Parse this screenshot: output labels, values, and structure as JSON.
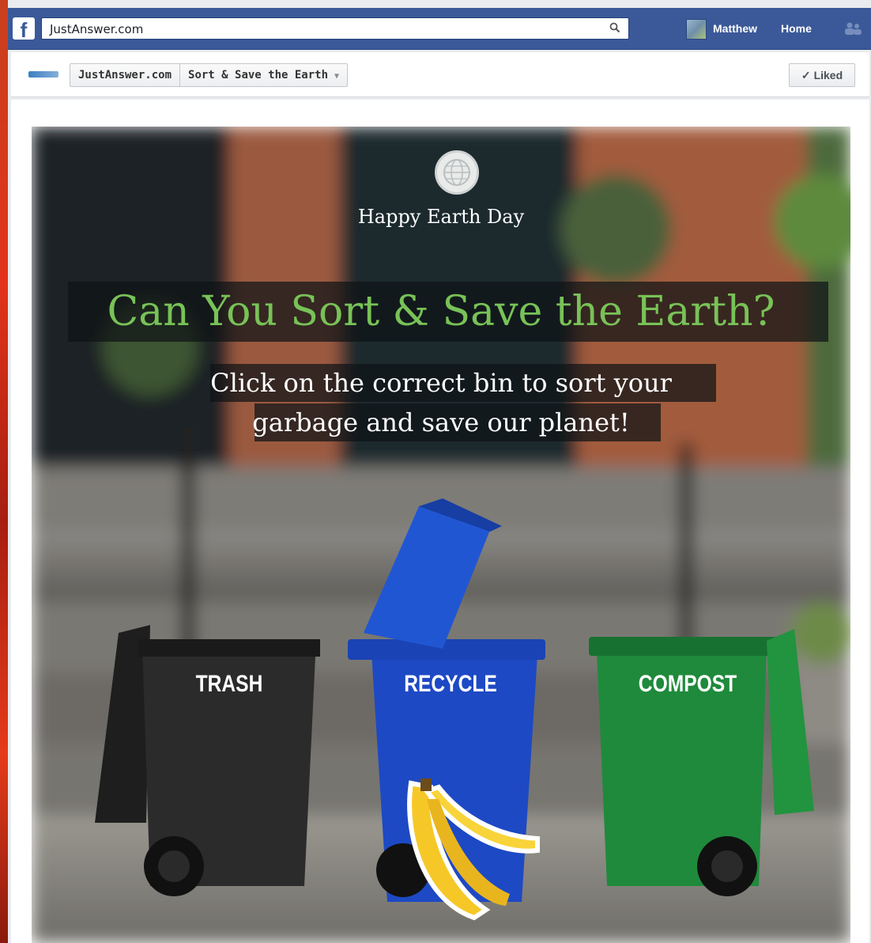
{
  "browser": {
    "search_text": "JustAnswer.com",
    "user_name": "Matthew",
    "home_label": "Home"
  },
  "page_header": {
    "crumbs": [
      "JustAnswer.com",
      "Sort & Save the Earth"
    ],
    "liked_label": "Liked"
  },
  "game": {
    "badge_text": "Happy Earth Day",
    "headline": "Can You Sort & Save the Earth?",
    "instruction_line1": "Click on the correct bin to sort your",
    "instruction_line2": "garbage and save our planet!",
    "bins": [
      {
        "label": "TRASH",
        "color": "#2a2a2a"
      },
      {
        "label": "RECYCLE",
        "color": "#1f4fc9"
      },
      {
        "label": "COMPOST",
        "color": "#1f8a3b"
      }
    ],
    "item": "banana-peel"
  },
  "colors": {
    "facebook_blue": "#3b5998",
    "headline_green": "#78c257"
  }
}
